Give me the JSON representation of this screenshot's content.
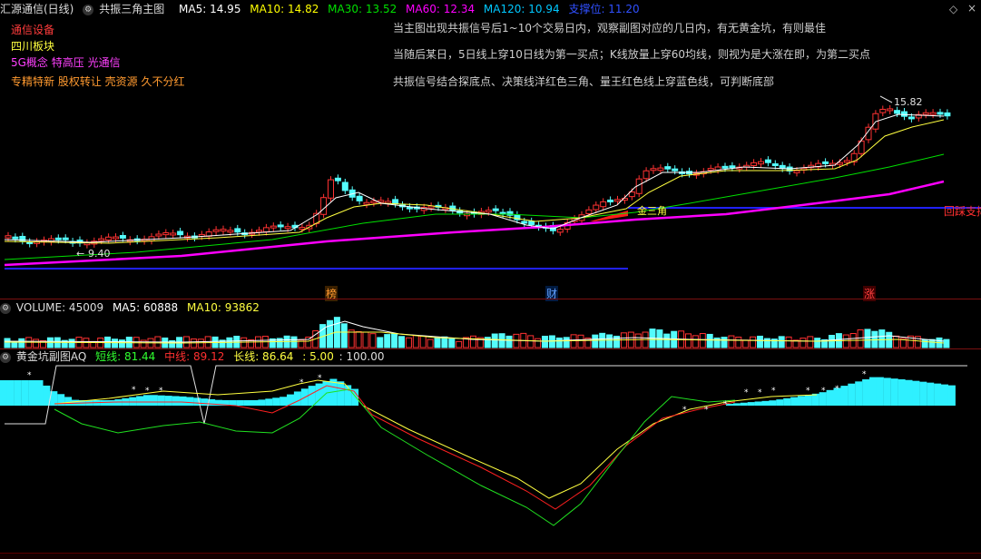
{
  "main_header": {
    "title": "汇源通信(日线)",
    "indicator": "共振三角主图",
    "ma5": "MA5: 14.95",
    "ma10": "MA10: 14.82",
    "ma30": "MA30: 13.52",
    "ma60": "MA60: 12.34",
    "ma120": "MA120: 10.94",
    "support": "支撑位: 11.20"
  },
  "tags": [
    "通信设备",
    "四川板块",
    "5G概念 特高压 光通信",
    "专精特新 股权转让 壳资源 久不分红"
  ],
  "notes": [
    "当主图出现共振信号后1~10个交易日内，观察副图对应的几日内，有无黄金坑，有则最佳",
    "当随后某日，5日线上穿10日线为第一买点；K线放量上穿60均线，则视为是大涨在即，为第二买点",
    "共振信号结合探底点、决策线洋红色三角、量王红色线上穿蓝色线，可判断底部"
  ],
  "labels": {
    "high": "15.82",
    "low": "9.40",
    "triangle": "金三角",
    "pullback": "回踩支撑",
    "bang": "榜",
    "cai": "财",
    "zhang": "涨"
  },
  "volume_header": {
    "label": "VOLUME: 45009",
    "ma5": "MA5: 60888",
    "ma10": "MA10: 93862"
  },
  "sub_header": {
    "name": "黄金坑副图AQ",
    "short": "短线: 81.44",
    "mid": "中线: 89.12",
    "long": "长线: 86.64",
    "v1": ": 5.00",
    "v2": ": 100.00"
  },
  "colors": {
    "up": "#ff3232",
    "down": "#54fcfc",
    "ma5": "#ffffff",
    "ma10": "#ffff00",
    "ma30": "#00e000",
    "ma60": "#ff00ff",
    "ma120": "#00c8ff",
    "support": "#2020ff"
  }
}
